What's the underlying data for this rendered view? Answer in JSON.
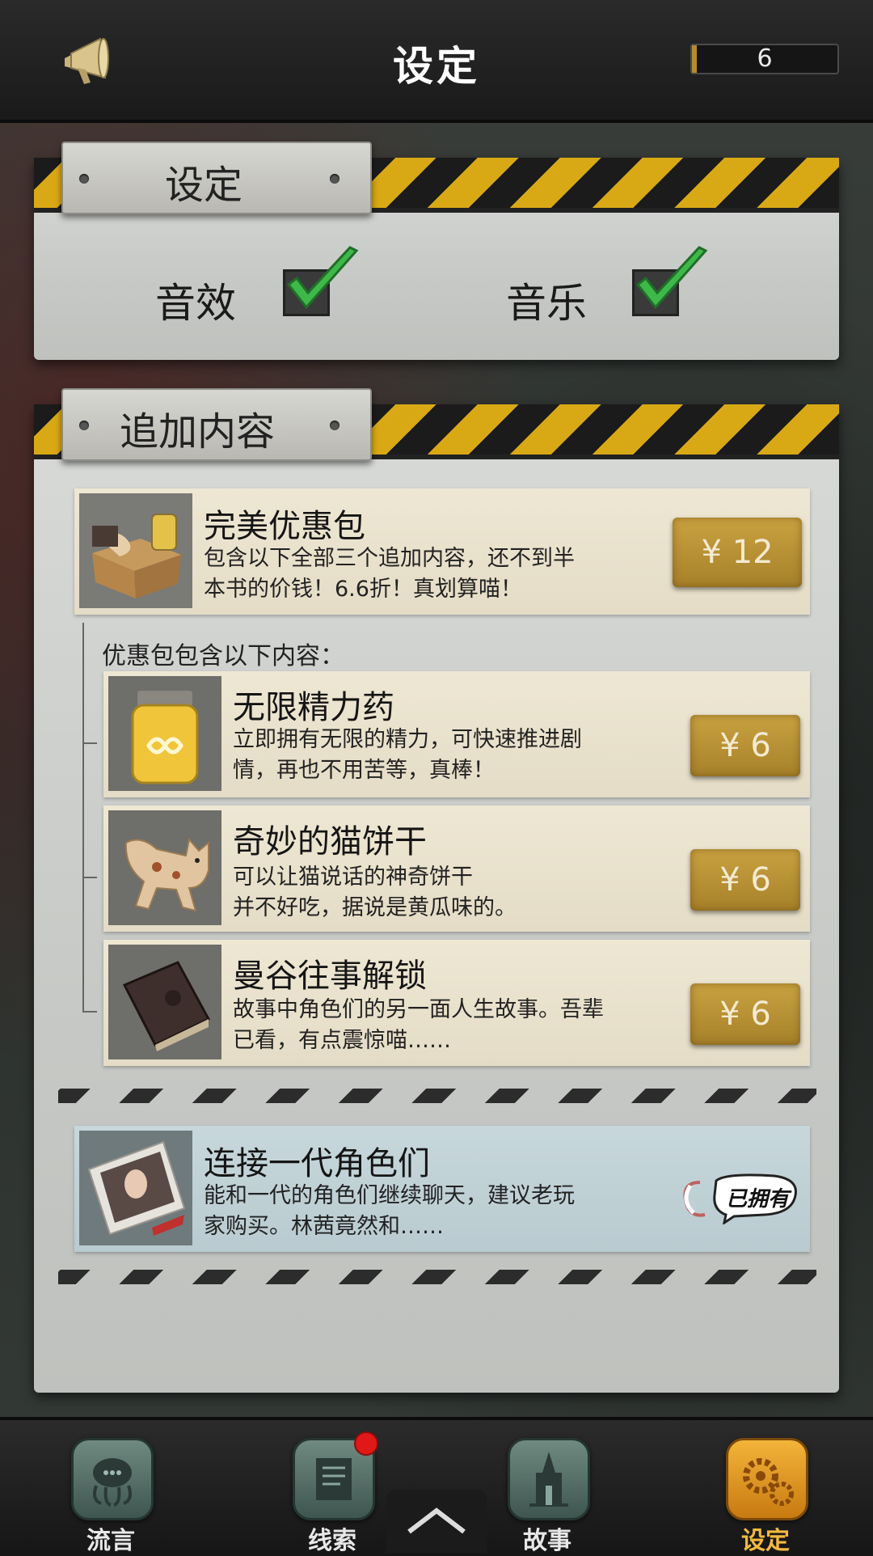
{
  "header": {
    "title": "设定",
    "counter_value": "6"
  },
  "settings_panel": {
    "tab_label": "设定",
    "sound_effects_label": "音效",
    "sound_effects_checked": true,
    "music_label": "音乐",
    "music_checked": true
  },
  "addons_panel": {
    "tab_label": "追加内容",
    "bundle": {
      "title": "完美优惠包",
      "description": "包含以下全部三个追加内容，还不到半\n本书的价钱！6.6折！真划算喵！",
      "price": "¥ 12"
    },
    "included_label": "优惠包包含以下内容：",
    "items": [
      {
        "title": "无限精力药",
        "description": "立即拥有无限的精力，可快速推进剧\n情，再也不用苦等，真棒！",
        "price": "¥ 6"
      },
      {
        "title": "奇妙的猫饼干",
        "description": "可以让猫说话的神奇饼干\n并不好吃，据说是黄瓜味的。",
        "price": "¥ 6"
      },
      {
        "title": "曼谷往事解锁",
        "description": "故事中角色们的另一面人生故事。吾辈\n已看，有点震惊喵……",
        "price": "¥ 6"
      }
    ],
    "connect": {
      "title": "连接一代角色们",
      "description": "能和一代的角色们继续聊天，建议老玩\n家购买。林茜竟然和……",
      "status": "已拥有"
    }
  },
  "bottom_nav": {
    "items": [
      {
        "label": "流言",
        "icon": "octopus-speech-icon",
        "active": false
      },
      {
        "label": "线索",
        "icon": "scroll-icon",
        "active": false,
        "has_badge": true
      },
      {
        "label": "故事",
        "icon": "tower-icon",
        "active": false
      },
      {
        "label": "设定",
        "icon": "gear-icon",
        "active": true
      }
    ],
    "up_icon": "chevron-up-icon"
  },
  "colors": {
    "accent_gold": "#c9a240",
    "active_orange": "#f2b940",
    "hazard_yellow": "#d9a915",
    "badge_red": "#e01818"
  }
}
